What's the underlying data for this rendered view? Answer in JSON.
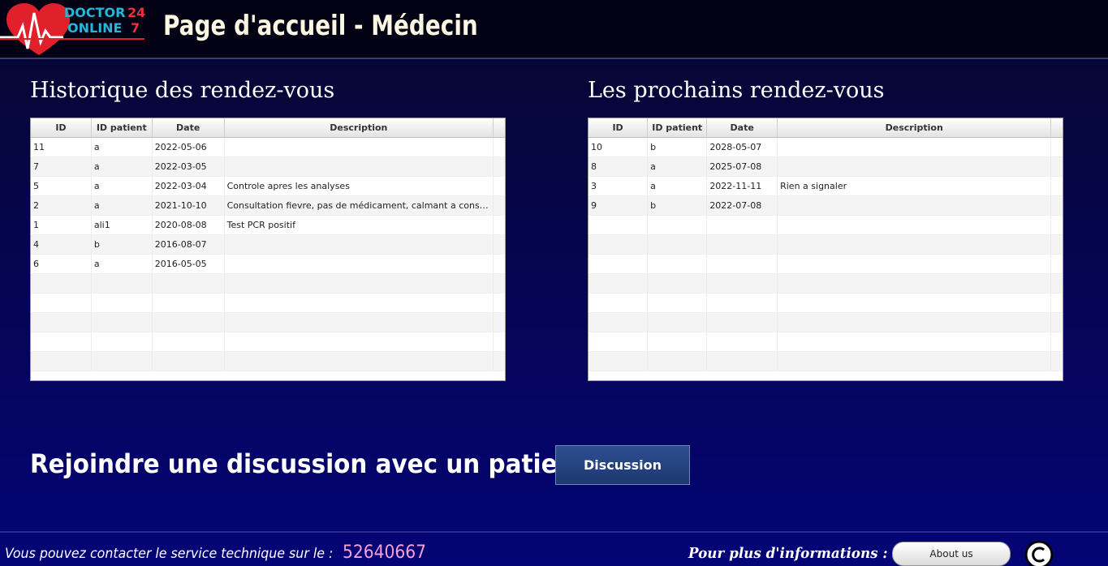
{
  "header": {
    "logo_text_1": "DOCTOR",
    "logo_text_2": "ONLINE",
    "logo_num_1": "24",
    "logo_num_2": "7",
    "title": "Page d'accueil - Médecin"
  },
  "history": {
    "title": "Historique des rendez-vous",
    "columns": [
      "ID",
      "ID patient",
      "Date",
      "Description"
    ],
    "rows": [
      {
        "id": "11",
        "patient": "a",
        "date": "2022-05-06",
        "desc": ""
      },
      {
        "id": "7",
        "patient": "a",
        "date": "2022-03-05",
        "desc": ""
      },
      {
        "id": "5",
        "patient": "a",
        "date": "2022-03-04",
        "desc": "Controle apres les analyses"
      },
      {
        "id": "2",
        "patient": "a",
        "date": "2021-10-10",
        "desc": "Consultation fievre, pas de médicament, calmant a consom..."
      },
      {
        "id": "1",
        "patient": "ali1",
        "date": "2020-08-08",
        "desc": "Test PCR positif"
      },
      {
        "id": "4",
        "patient": "b",
        "date": "2016-08-07",
        "desc": ""
      },
      {
        "id": "6",
        "patient": "a",
        "date": "2016-05-05",
        "desc": ""
      }
    ]
  },
  "upcoming": {
    "title": "Les prochains rendez-vous",
    "columns": [
      "ID",
      "ID patient",
      "Date",
      "Description"
    ],
    "rows": [
      {
        "id": "10",
        "patient": "b",
        "date": "2028-05-07",
        "desc": ""
      },
      {
        "id": "8",
        "patient": "a",
        "date": "2025-07-08",
        "desc": ""
      },
      {
        "id": "3",
        "patient": "a",
        "date": "2022-11-11",
        "desc": "Rien a signaler"
      },
      {
        "id": "9",
        "patient": "b",
        "date": "2022-07-08",
        "desc": ""
      }
    ]
  },
  "discussion": {
    "text": "Rejoindre une discussion avec un patient",
    "button_label": "Discussion"
  },
  "footer": {
    "contact_text": "Vous pouvez contacter le service technique sur le :",
    "phone": "52640667",
    "more_info": "Pour plus d'informations :",
    "about_label": "About us"
  },
  "colors": {
    "accent_blue": "#27b5d8",
    "accent_red": "#e8323c",
    "button_blue": "#2d4e8f",
    "phone_pink": "#f5a0d8"
  }
}
